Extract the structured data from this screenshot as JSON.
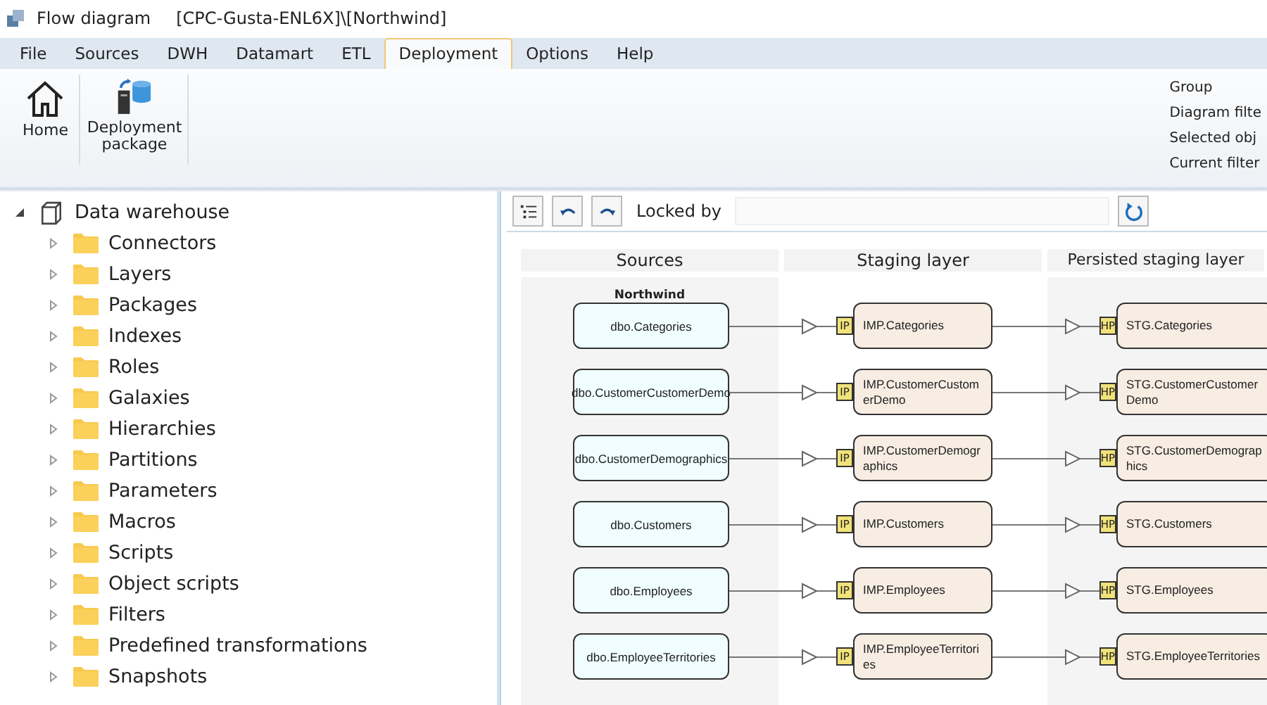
{
  "window": {
    "title": "Flow diagram",
    "path": "[CPC-Gusta-ENL6X]\\[Northwind]"
  },
  "menu": [
    {
      "label": "File",
      "selected": false
    },
    {
      "label": "Sources",
      "selected": false
    },
    {
      "label": "DWH",
      "selected": false
    },
    {
      "label": "Datamart",
      "selected": false
    },
    {
      "label": "ETL",
      "selected": false
    },
    {
      "label": "Deployment",
      "selected": true
    },
    {
      "label": "Options",
      "selected": false
    },
    {
      "label": "Help",
      "selected": false
    }
  ],
  "ribbon": {
    "buttons": [
      {
        "kind": "home",
        "label": "Home"
      },
      {
        "kind": "package",
        "label": "Deployment package"
      }
    ],
    "side_labels": [
      "Group",
      "Diagram filte",
      "Selected obj",
      "Current filter"
    ]
  },
  "tree": {
    "label": "Data warehouse",
    "expanded": true,
    "children": [
      {
        "label": "Connectors",
        "expanded": false
      },
      {
        "label": "Layers",
        "expanded": false
      },
      {
        "label": "Packages",
        "expanded": false
      },
      {
        "label": "Indexes",
        "expanded": false
      },
      {
        "label": "Roles",
        "expanded": false
      },
      {
        "label": "Galaxies",
        "expanded": false
      },
      {
        "label": "Hierarchies",
        "expanded": false
      },
      {
        "label": "Partitions",
        "expanded": false
      },
      {
        "label": "Parameters",
        "expanded": false
      },
      {
        "label": "Macros",
        "expanded": false
      },
      {
        "label": "Scripts",
        "expanded": false
      },
      {
        "label": "Object scripts",
        "expanded": false
      },
      {
        "label": "Filters",
        "expanded": false
      },
      {
        "label": "Predefined transformations",
        "expanded": false
      },
      {
        "label": "Snapshots",
        "expanded": false
      }
    ]
  },
  "toolbar": {
    "locked_label": "Locked by"
  },
  "diagram": {
    "columns": [
      "Sources",
      "Staging layer",
      "Persisted staging layer"
    ],
    "source_group": "Northwind",
    "rows": [
      {
        "source": "dbo.Categories",
        "staging_badge": "IP",
        "staging": "IMP.Categories",
        "persisted_badge": "HP",
        "persisted": "STG.Categories"
      },
      {
        "source": "dbo.CustomerCustomerDemo",
        "staging_badge": "IP",
        "staging": "IMP.CustomerCustomerDemo",
        "persisted_badge": "HP",
        "persisted": "STG.CustomerCustomerDemo"
      },
      {
        "source": "dbo.CustomerDemographics",
        "staging_badge": "IP",
        "staging": "IMP.CustomerDemographics",
        "persisted_badge": "HP",
        "persisted": "STG.CustomerDemographics"
      },
      {
        "source": "dbo.Customers",
        "staging_badge": "IP",
        "staging": "IMP.Customers",
        "persisted_badge": "HP",
        "persisted": "STG.Customers"
      },
      {
        "source": "dbo.Employees",
        "staging_badge": "IP",
        "staging": "IMP.Employees",
        "persisted_badge": "HP",
        "persisted": "STG.Employees"
      },
      {
        "source": "dbo.EmployeeTerritories",
        "staging_badge": "IP",
        "staging": "IMP.EmployeeTerritories",
        "persisted_badge": "HP",
        "persisted": "STG.EmployeeTerritories"
      }
    ]
  }
}
